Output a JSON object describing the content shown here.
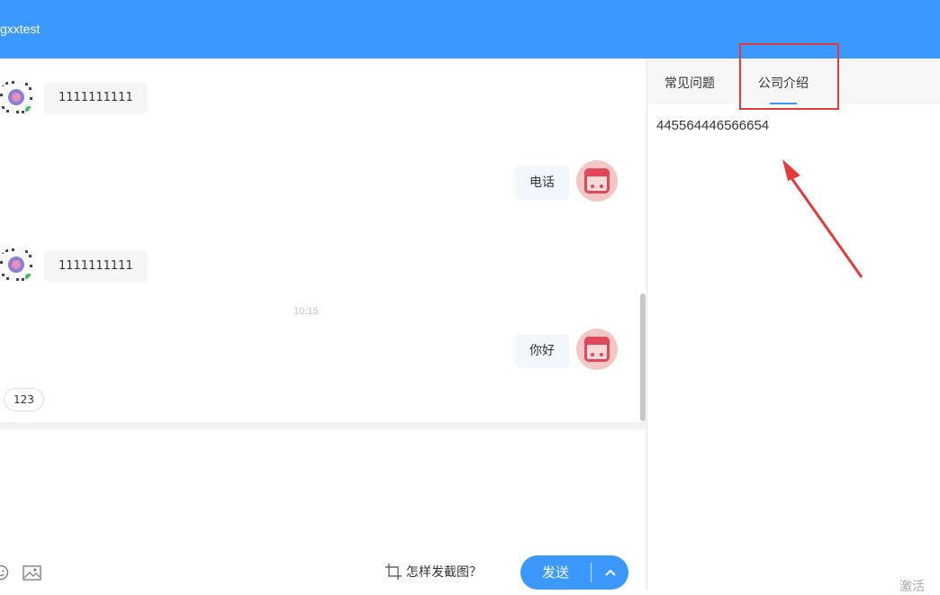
{
  "header": {
    "title": "gxxtest"
  },
  "chat": {
    "messages": [
      {
        "side": "left",
        "text": "1111111111"
      },
      {
        "side": "right",
        "text": "电话"
      },
      {
        "side": "left",
        "text": "1111111111"
      },
      {
        "side": "right",
        "text": "你好"
      }
    ],
    "timestamp": "10:15",
    "quick_reply": "123"
  },
  "input": {
    "howto_label": "怎样发截图？",
    "send_label": "发送"
  },
  "side": {
    "tabs": [
      "常见问题",
      "公司介绍"
    ],
    "active_tab": "公司介绍",
    "content": "445564446566654",
    "watermark": "激活"
  },
  "colors": {
    "brand": "#3a98fe",
    "annotation": "#e63a3a"
  }
}
